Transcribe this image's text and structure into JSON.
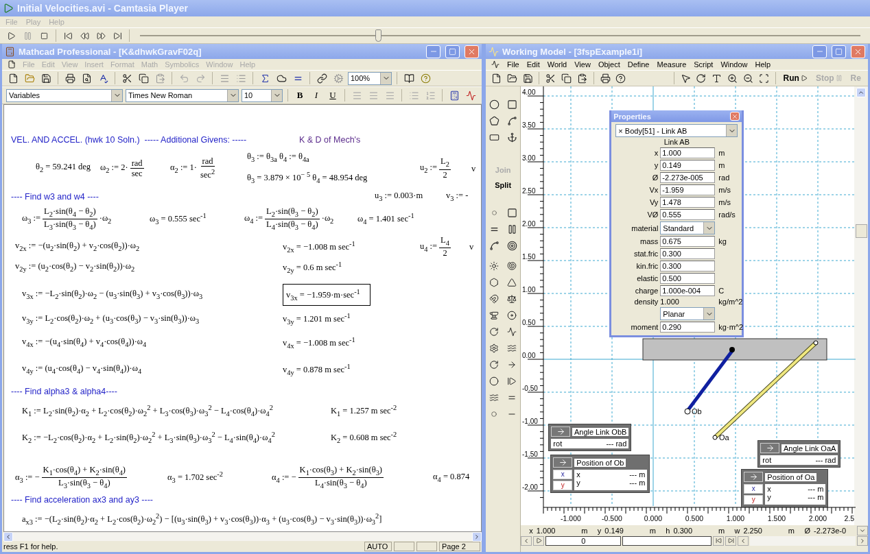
{
  "player": {
    "title": "Initial Velocities.avi - Camtasia Player",
    "menu": [
      "File",
      "Play",
      "Help"
    ],
    "seek": {
      "level": 0.33
    }
  },
  "mathcad": {
    "title": "Mathcad Professional - [K&dhwkGravF02q]",
    "menu": [
      "File",
      "Edit",
      "View",
      "Insert",
      "Format",
      "Math",
      "Symbolics",
      "Window",
      "Help"
    ],
    "zoom": "100%",
    "style": "Variables",
    "font": "Times New Roman",
    "size": "10",
    "format_buttons": [
      "B",
      "I",
      "U"
    ],
    "rows": [
      {
        "items": [
          {
            "kind": "heading",
            "text": "VEL. AND ACCEL. (hwk 10 Soln.)  ----- Additional Givens: -----"
          },
          {
            "kind": "note",
            "text": "K & D of Mech's"
          }
        ]
      },
      {
        "items": [
          {
            "kind": "expr",
            "text": "θ$_{2}$ = 59.241 deg"
          },
          {
            "kind": "frac",
            "before": "ω$_{2}$ := 2·",
            "num": "rad",
            "den": "sec"
          },
          {
            "kind": "frac",
            "before": "α$_{2}$ := 1·",
            "num": "rad",
            "den": "sec$^{2}$"
          },
          {
            "kind": "stack",
            "lines": [
              "θ$_{3}$ := θ$_{3a}$          θ$_{4}$ := θ$_{4a}$",
              "θ$_{3}$ = 3.879 × 10$^{− 5}$ θ$_{4}$ = 48.954 deg"
            ]
          },
          {
            "kind": "frac",
            "before": "u$_{2}$ :=",
            "num": "L$_{2}$",
            "den": "2"
          },
          {
            "kind": "expr",
            "text": "v"
          }
        ]
      },
      {
        "items": [
          {
            "kind": "heading",
            "text": "---- Find w3 and w4 ----"
          },
          {
            "kind": "expr",
            "text": "u$_{3}$ := 0.003·m"
          },
          {
            "kind": "expr",
            "text": "v$_{3}$ := -"
          }
        ]
      },
      {
        "items": [
          {
            "kind": "frac",
            "before": "ω$_{3}$ :=",
            "num": "L$_{2}$·sin(θ$_{4}$ − θ$_{2}$)",
            "den": "L$_{3}$·sin(θ$_{3}$ − θ$_{4}$)",
            "after": "·ω$_{2}$"
          },
          {
            "kind": "expr",
            "text": "ω$_{3}$ = 0.555 sec$^{-1}$"
          },
          {
            "kind": "frac",
            "before": "ω$_{4}$ :=",
            "num": "L$_{2}$·sin(θ$_{3}$ − θ$_{2}$)",
            "den": "L$_{4}$·sin(θ$_{3}$ − θ$_{4}$)",
            "after": "·ω$_{2}$"
          },
          {
            "kind": "expr",
            "text": "ω$_{4}$ = 1.401 sec$^{-1}$"
          }
        ]
      },
      {
        "items": [
          {
            "kind": "expr",
            "text": "v$_{2x}$ := −(u$_{2}$·sin(θ$_{2}$) + v$_{2}$·cos(θ$_{2}$))·ω$_{2}$"
          },
          {
            "kind": "expr",
            "text": "v$_{2x}$ = −1.008 m sec$^{-1}$"
          },
          {
            "kind": "frac",
            "before": "u$_{4}$ :=",
            "num": "L$_{4}$",
            "den": "2"
          },
          {
            "kind": "expr",
            "text": "v"
          }
        ]
      },
      {
        "items": [
          {
            "kind": "expr",
            "text": "v$_{2y}$ := (u$_{2}$·cos(θ$_{2}$) − v$_{2}$·sin(θ$_{2}$))·ω$_{2}$"
          },
          {
            "kind": "expr",
            "text": "v$_{2y}$ = 0.6 m sec$^{-1}$"
          }
        ]
      },
      {
        "items": [
          {
            "kind": "expr",
            "text": "v$_{3x}$ := −L$_{2}$·sin(θ$_{2}$)·ω$_{2}$ − (u$_{3}$·sin(θ$_{3}$) + v$_{3}$·cos(θ$_{3}$))·ω$_{3}$"
          },
          {
            "kind": "boxed",
            "text": "v$_{3x}$ = −1.959·m·sec$^{-1}$"
          }
        ]
      },
      {
        "items": [
          {
            "kind": "expr",
            "text": "v$_{3y}$ := L$_{2}$·cos(θ$_{2}$)·ω$_{2}$ + (u$_{3}$·cos(θ$_{3}$) − v$_{3}$·sin(θ$_{3}$))·ω$_{3}$"
          },
          {
            "kind": "expr",
            "text": "v$_{3y}$ = 1.201 m sec$^{-1}$"
          }
        ]
      },
      {
        "items": [
          {
            "kind": "expr",
            "text": "v$_{4x}$ := −(u$_{4}$·sin(θ$_{4}$) + v$_{4}$·cos(θ$_{4}$))·ω$_{4}$"
          },
          {
            "kind": "expr",
            "text": "v$_{4x}$ = −1.008 m sec$^{-1}$"
          }
        ]
      },
      {
        "items": [
          {
            "kind": "expr",
            "text": "v$_{4y}$ := (u$_{4}$·cos(θ$_{4}$) − v$_{4}$·sin(θ$_{4}$))·ω$_{4}$"
          },
          {
            "kind": "expr",
            "text": "v$_{4y}$ = 0.878 m sec$^{-1}$"
          }
        ]
      },
      {
        "items": [
          {
            "kind": "heading",
            "text": "---- Find alpha3 & alpha4----"
          }
        ]
      },
      {
        "items": [
          {
            "kind": "expr",
            "text": "K$_{1}$ := L$_{2}$·sin(θ$_{2}$)·α$_{2}$ + L$_{2}$·cos(θ$_{2}$)·ω$_{2}$$^{2}$ + L$_{3}$·cos(θ$_{3}$)·ω$_{3}$$^{2}$ − L$_{4}$·cos(θ$_{4}$)·ω$_{4}$$^{2}$"
          },
          {
            "kind": "expr",
            "text": "K$_{1}$ = 1.257 m sec$^{-2}$"
          }
        ]
      },
      {
        "items": [
          {
            "kind": "expr",
            "text": "K$_{2}$ := −L$_{2}$·cos(θ$_{2}$)·α$_{2}$ + L$_{2}$·sin(θ$_{2}$)·ω$_{2}$$^{2}$ + L$_{3}$·sin(θ$_{3}$)·ω$_{3}$$^{2}$ − L$_{4}$·sin(θ$_{4}$)·ω$_{4}$$^{2}$"
          },
          {
            "kind": "expr",
            "text": "K$_{2}$ = 0.608 m sec$^{-2}$"
          }
        ]
      },
      {
        "items": [
          {
            "kind": "frac",
            "before": "α$_{3}$ := −",
            "num": "K$_{1}$·cos(θ$_{4}$) + K$_{2}$·sin(θ$_{4}$)",
            "den": "L$_{3}$·sin(θ$_{3}$ − θ$_{4}$)"
          },
          {
            "kind": "expr",
            "text": "α$_{3}$ = 1.702 sec$^{-2}$"
          },
          {
            "kind": "frac",
            "before": "α$_{4}$ := −",
            "num": "K$_{1}$·cos(θ$_{3}$) + K$_{2}$·sin(θ$_{3}$)",
            "den": "L$_{4}$·sin(θ$_{3}$ − θ$_{4}$)"
          },
          {
            "kind": "expr",
            "text": "α$_{4}$ = 0.874"
          }
        ]
      },
      {
        "items": [
          {
            "kind": "heading",
            "text": "---- Find acceleration ax3 and ay3 ----"
          }
        ]
      },
      {
        "items": [
          {
            "kind": "expr",
            "text": "a$_{x3}$ := −(L$_{2}$·sin(θ$_{2}$)·α$_{2}$ + L$_{2}$·cos(θ$_{2}$)·ω$_{2}$$^{2}$) − [(u$_{3}$·sin(θ$_{3}$) + v$_{3}$·cos(θ$_{3}$))·α$_{3}$ + (u$_{3}$·cos(θ$_{3}$) − v$_{3}$·sin(θ$_{3}$))·ω$_{3}$$^{2}$]"
          }
        ]
      }
    ],
    "status": {
      "message": "ress F1 for help.",
      "mode": "AUTO",
      "page": "Page 2"
    }
  },
  "working_model": {
    "title": "Working Model - [3fspExample1i]",
    "menu": [
      "File",
      "Edit",
      "World",
      "View",
      "Object",
      "Define",
      "Measure",
      "Script",
      "Window",
      "Help"
    ],
    "run_buttons": [
      {
        "label": "Run",
        "disabled": false
      },
      {
        "label": "Stop",
        "disabled": true
      },
      {
        "label": "Re",
        "disabled": true
      }
    ],
    "palette_buttons": [
      {
        "label": "Join",
        "disabled": true
      },
      {
        "label": "Split",
        "disabled": false
      }
    ],
    "y_ticks": [
      "4.00",
      "3.50",
      "3.00",
      "2.50",
      "2.00",
      "1.50",
      "1.00",
      "0.50",
      "0.00",
      "-0.50",
      "-1.00",
      "-1.50",
      "-2.00"
    ],
    "x_ticks": [
      "-1.000",
      "-0.500",
      "0.000",
      "0.500",
      "1.000",
      "1.500",
      "2.000",
      "2.5"
    ],
    "point_labels": [
      "Ob",
      "Oa"
    ],
    "properties": {
      "title": "Properties",
      "object": "× Body[51] - Link AB",
      "name": "Link AB",
      "fields": [
        {
          "kind": "field",
          "label": "x",
          "value": "1.000",
          "unit": "m"
        },
        {
          "kind": "field",
          "label": "y",
          "value": "0.149",
          "unit": "m"
        },
        {
          "kind": "field",
          "label": "Ø",
          "value": "-2.273e-005",
          "unit": "rad"
        },
        {
          "kind": "field",
          "label": "Vx",
          "value": "-1.959",
          "unit": "m/s"
        },
        {
          "kind": "field",
          "label": "Vy",
          "value": "1.478",
          "unit": "m/s"
        },
        {
          "kind": "field",
          "label": "VØ",
          "value": "0.555",
          "unit": "rad/s"
        },
        {
          "kind": "dropdown",
          "label": "material",
          "value": "Standard"
        },
        {
          "kind": "field",
          "label": "mass",
          "value": "0.675",
          "unit": "kg"
        },
        {
          "kind": "field",
          "label": "stat.fric",
          "value": "0.300"
        },
        {
          "kind": "field",
          "label": "kin.fric",
          "value": "0.300"
        },
        {
          "kind": "field",
          "label": "elastic",
          "value": "0.500"
        },
        {
          "kind": "field",
          "label": "charge",
          "value": "1.000e-004",
          "unit": "C"
        },
        {
          "kind": "static",
          "label": "density",
          "value": "1.000",
          "unit": "kg/m^2"
        },
        {
          "kind": "dropdown",
          "value": "Planar"
        },
        {
          "kind": "field",
          "label": "moment",
          "value": "0.290",
          "unit": "kg·m^2"
        }
      ]
    },
    "meters": [
      {
        "kind": "angle",
        "title": "Angle Link ObB",
        "rows": [
          {
            "label": "rot",
            "value": "--- rad"
          }
        ]
      },
      {
        "kind": "position",
        "title": "Position of Ob",
        "axes": [
          "x",
          "y"
        ],
        "rows": [
          {
            "label": "x",
            "value": "--- m"
          },
          {
            "label": "y",
            "value": "--- m"
          }
        ]
      },
      {
        "kind": "angle",
        "title": "Angle Link OaA",
        "rows": [
          {
            "label": "rot",
            "value": "--- rad"
          }
        ]
      },
      {
        "kind": "position",
        "title": "Position of Oa",
        "axes": [
          "x",
          "y"
        ],
        "rows": [
          {
            "label": "x",
            "value": "--- m"
          },
          {
            "label": "y",
            "value": "--- m"
          }
        ]
      }
    ],
    "coordinates": [
      {
        "label": "x",
        "value": "1.000",
        "unit": "m"
      },
      {
        "label": "y",
        "value": "0.149",
        "unit": "m"
      },
      {
        "label": "h",
        "value": "0.300",
        "unit": "m"
      },
      {
        "label": "w",
        "value": "2.250",
        "unit": "m"
      },
      {
        "label": "Ø",
        "value": "-2.273e-0"
      }
    ],
    "frame": "0"
  }
}
